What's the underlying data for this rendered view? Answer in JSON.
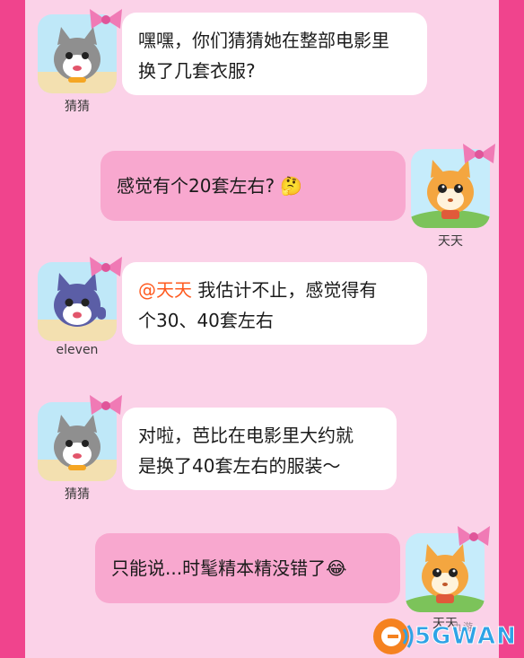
{
  "colors": {
    "frame": "#f0448d",
    "panel": "#fbd2e8",
    "bubble_white": "#ffffff",
    "bubble_pink": "#f8a8cf",
    "mention": "#ff5a1f",
    "watermark_blue": "#2fa3e6"
  },
  "messages": [
    {
      "sender": "猜猜",
      "avatar": "grey-cat-avatar",
      "side": "left",
      "line1": "嘿嘿，你们猜猜她在整部电影里",
      "line2": "换了几套衣服?"
    },
    {
      "sender": "天天",
      "avatar": "orange-cat-avatar",
      "side": "right",
      "line1": "感觉有个20套左右? 🤔"
    },
    {
      "sender": "eleven",
      "avatar": "blue-cat-avatar",
      "side": "left",
      "mention": "@天天",
      "line1_rest": " 我估计不止，感觉得有",
      "line2": "个30、40套左右"
    },
    {
      "sender": "猜猜",
      "avatar": "grey-cat-avatar",
      "side": "left",
      "line1": "对啦，芭比在电影里大约就",
      "line2": "是换了40套左右的服装～"
    },
    {
      "sender": "天天",
      "avatar": "orange-cat-avatar",
      "side": "right",
      "line1": "只能说...时髦精本精没错了😂"
    }
  ],
  "watermark": {
    "brand": "5GWAN",
    "small_text": "九游"
  }
}
